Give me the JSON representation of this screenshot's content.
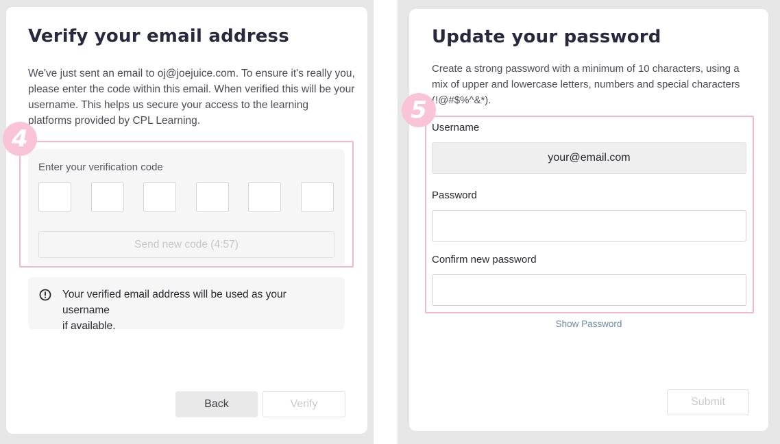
{
  "verify_card": {
    "title": "Verify your email address",
    "description_lines": [
      "We've just sent an email to oj@joejuice.com. To ensure it's really you,",
      "please enter the code within this email. When verified this will be your",
      "username. This helps us secure your access to the learning",
      "platforms provided by CPL Learning."
    ],
    "code_label": "Enter your verification code",
    "code_digits": [
      "",
      "",
      "",
      "",
      "",
      ""
    ],
    "send_new_code_label": "Send new code (4:57)",
    "info_lines": [
      "Your verified email address will be used as your username",
      "if available."
    ],
    "back_label": "Back",
    "verify_label": "Verify"
  },
  "password_card": {
    "title": "Update your password",
    "description_lines": [
      "Create a strong password with a minimum of 10 characters, using a",
      "mix of upper and lowercase letters, numbers and special characters",
      "(!@#$%^&*)."
    ],
    "username_label": "Username",
    "username_value": "your@email.com",
    "password_label": "Password",
    "password_value": "",
    "confirm_label": "Confirm new password",
    "confirm_value": "",
    "show_password_label": "Show Password",
    "submit_label": "Submit"
  },
  "annotations": {
    "step_4": "4",
    "step_5": "5",
    "highlight_color": "#f4b6cc",
    "bubble_color": "#f9c3d8"
  },
  "icons": {
    "info": "info-circle-icon"
  }
}
